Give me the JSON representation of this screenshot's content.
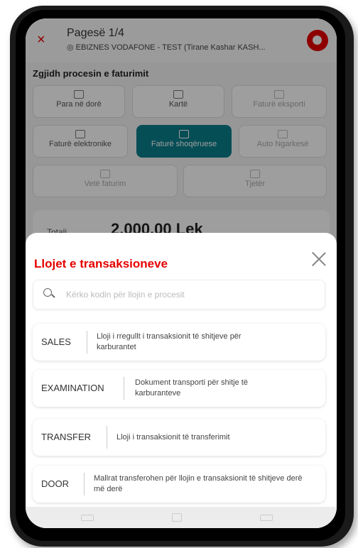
{
  "header": {
    "close_glyph": "×",
    "title": "Pagesë 1/4",
    "location_icon": "location-pin-icon",
    "subtitle": "EBIZNES VODAFONE - TEST (Tirane Kashar KASH...",
    "logo_icon": "vodafone-logo-icon"
  },
  "process": {
    "title": "Zgjidh procesin e faturimit",
    "options": [
      {
        "label": "Para në dorë",
        "icon": "cash-icon",
        "state": "normal"
      },
      {
        "label": "Kartë",
        "icon": "card-icon",
        "state": "normal"
      },
      {
        "label": "Faturë eksporti",
        "icon": "document-icon",
        "state": "disabled"
      },
      {
        "label": "Faturë elektronike",
        "icon": "e-invoice-icon",
        "state": "normal"
      },
      {
        "label": "Faturë shoqëruese",
        "icon": "document-icon",
        "state": "selected"
      },
      {
        "label": "Auto Ngarkesë",
        "icon": "document-icon",
        "state": "disabled"
      },
      {
        "label": "Vetë faturim",
        "icon": "document-icon",
        "state": "disabled"
      },
      {
        "label": "Tjetër",
        "icon": "card-icon",
        "state": "disabled"
      }
    ]
  },
  "total": {
    "label": "Totali",
    "value": "2.000,00 Lek"
  },
  "sheet": {
    "title": "Llojet e transaksioneve",
    "search_placeholder": "Kërko kodin për llojin e procesit",
    "items": [
      {
        "code": "SALES",
        "description": "Lloji i rregullt i transaksionit të shitjeve për karburantet"
      },
      {
        "code": "EXAMINATION",
        "description": "Dokument transporti për shitje të karburanteve"
      },
      {
        "code": "TRANSFER",
        "description": "Lloji i transaksionit të transferimit"
      },
      {
        "code": "DOOR",
        "description": "Mallrat transferohen për llojin e transaksionit të shitjeve derë më derë"
      }
    ]
  },
  "colors": {
    "accent": "#e60000",
    "selected": "#0a7e8c"
  }
}
